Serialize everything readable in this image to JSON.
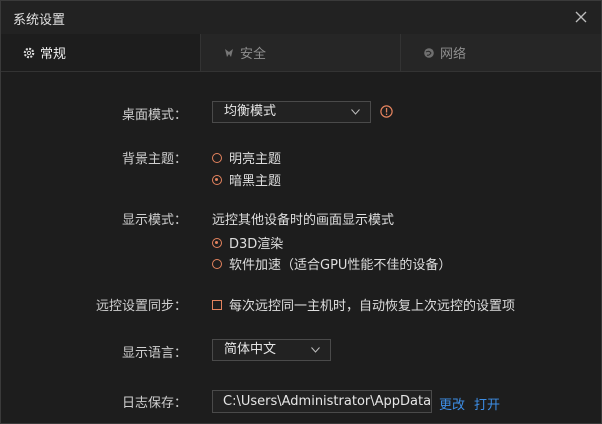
{
  "window": {
    "title": "系统设置"
  },
  "tabs": [
    {
      "label": "常规",
      "icon": "gear-icon",
      "active": true
    },
    {
      "label": "安全",
      "icon": "shield-icon",
      "active": false
    },
    {
      "label": "网络",
      "icon": "globe-icon",
      "active": false
    }
  ],
  "desktop_mode": {
    "label": "桌面模式：",
    "value": "均衡模式"
  },
  "theme": {
    "label": "背景主题：",
    "options": [
      "明亮主题",
      "暗黑主题"
    ],
    "selected": "暗黑主题"
  },
  "display_mode": {
    "label": "显示模式：",
    "description": "远控其他设备时的画面显示模式",
    "options": [
      "D3D渲染",
      "软件加速（适合GPU性能不佳的设备）"
    ],
    "selected": "D3D渲染"
  },
  "sync": {
    "label": "远控设置同步：",
    "checkbox_label": "每次远控同一主机时，自动恢复上次远控的设置项",
    "checked": false
  },
  "language": {
    "label": "显示语言：",
    "value": "简体中文"
  },
  "log": {
    "label": "日志保存：",
    "path": "C:\\Users\\Administrator\\AppData\\",
    "change_link": "更改",
    "open_link": "打开"
  },
  "colors": {
    "accent": "#e4835e",
    "link": "#3d8ee6"
  }
}
